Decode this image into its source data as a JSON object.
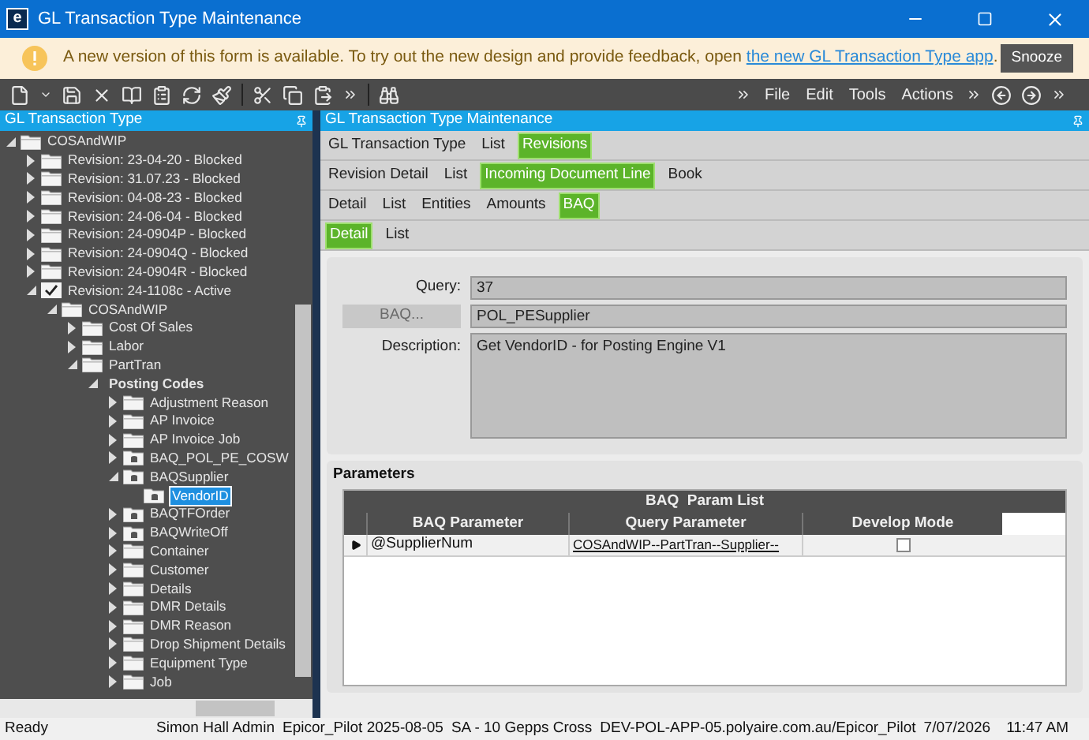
{
  "window": {
    "logo": "e",
    "title": "GL Transaction Type Maintenance"
  },
  "notice": {
    "text": "A new version of this form is available. To try out the new design and provide feedback, open ",
    "link": "the new GL Transaction Type app",
    "after": ".",
    "button": "Snooze"
  },
  "menus": [
    "File",
    "Edit",
    "Tools",
    "Actions"
  ],
  "tree_panel": {
    "title": "GL Transaction Type",
    "items": [
      {
        "label": "COSAndWIP",
        "kind": "folder",
        "expanded": true,
        "selected": false,
        "children": [
          {
            "label": "Revision: 23-04-20 - Blocked",
            "kind": "folder",
            "expanded": false,
            "selected": false
          },
          {
            "label": "Revision: 31.07.23 - Blocked",
            "kind": "folder",
            "expanded": false,
            "selected": false
          },
          {
            "label": "Revision: 04-08-23 - Blocked",
            "kind": "folder",
            "expanded": false,
            "selected": false
          },
          {
            "label": "Revision: 24-06-04 - Blocked",
            "kind": "folder",
            "expanded": false,
            "selected": false
          },
          {
            "label": "Revision: 24-0904P - Blocked",
            "kind": "folder",
            "expanded": false,
            "selected": false
          },
          {
            "label": "Revision: 24-0904Q - Blocked",
            "kind": "folder",
            "expanded": false,
            "selected": false
          },
          {
            "label": "Revision: 24-0904R - Blocked",
            "kind": "folder",
            "expanded": false,
            "selected": false
          },
          {
            "label": "Revision: 24-1108c - Active",
            "kind": "check",
            "expanded": true,
            "selected": false,
            "children": [
              {
                "label": "COSAndWIP",
                "kind": "folder",
                "expanded": true,
                "selected": false,
                "children": [
                  {
                    "label": "Cost Of Sales",
                    "kind": "folder",
                    "expanded": false,
                    "selected": false
                  },
                  {
                    "label": "Labor",
                    "kind": "folder",
                    "expanded": false,
                    "selected": false
                  },
                  {
                    "label": "PartTran",
                    "kind": "folder",
                    "expanded": true,
                    "selected": false,
                    "children": [
                      {
                        "label": "Posting Codes",
                        "kind": "group",
                        "expanded": true,
                        "selected": false,
                        "children": [
                          {
                            "label": "Adjustment Reason",
                            "kind": "folder",
                            "expanded": false,
                            "selected": false
                          },
                          {
                            "label": "AP Invoice",
                            "kind": "folder",
                            "expanded": false,
                            "selected": false
                          },
                          {
                            "label": "AP Invoice Job",
                            "kind": "folder",
                            "expanded": false,
                            "selected": false
                          },
                          {
                            "label": "BAQ_POL_PE_COSW",
                            "kind": "baq",
                            "expanded": false,
                            "selected": false
                          },
                          {
                            "label": "BAQSupplier",
                            "kind": "baq",
                            "expanded": true,
                            "selected": false,
                            "children": [
                              {
                                "label": "VendorID",
                                "kind": "baq",
                                "selected": true
                              }
                            ]
                          },
                          {
                            "label": "BAQTFOrder",
                            "kind": "baq",
                            "expanded": false,
                            "selected": false
                          },
                          {
                            "label": "BAQWriteOff",
                            "kind": "baq",
                            "expanded": false,
                            "selected": false
                          },
                          {
                            "label": "Container",
                            "kind": "folder",
                            "expanded": false,
                            "selected": false
                          },
                          {
                            "label": "Customer",
                            "kind": "folder",
                            "expanded": false,
                            "selected": false
                          },
                          {
                            "label": "Details",
                            "kind": "folder",
                            "expanded": false,
                            "selected": false
                          },
                          {
                            "label": "DMR Details",
                            "kind": "folder",
                            "expanded": false,
                            "selected": false
                          },
                          {
                            "label": "DMR Reason",
                            "kind": "folder",
                            "expanded": false,
                            "selected": false
                          },
                          {
                            "label": "Drop Shipment Details",
                            "kind": "folder",
                            "expanded": false,
                            "selected": false
                          },
                          {
                            "label": "Equipment Type",
                            "kind": "folder",
                            "expanded": false,
                            "selected": false
                          },
                          {
                            "label": "Job",
                            "kind": "folder",
                            "expanded": false,
                            "selected": false
                          }
                        ]
                      }
                    ]
                  }
                ]
              }
            ]
          }
        ]
      }
    ]
  },
  "main_panel": {
    "title": "GL Transaction Type Maintenance",
    "tab_rows": [
      [
        {
          "label": "GL Transaction Type",
          "selected": false
        },
        {
          "label": "List",
          "selected": false
        },
        {
          "label": "Revisions",
          "selected": true
        }
      ],
      [
        {
          "label": "Revision Detail",
          "selected": false
        },
        {
          "label": "List",
          "selected": false
        },
        {
          "label": "Incoming Document Line",
          "selected": true
        },
        {
          "label": "Book",
          "selected": false
        }
      ],
      [
        {
          "label": "Detail",
          "selected": false
        },
        {
          "label": "List",
          "selected": false
        },
        {
          "label": "Entities",
          "selected": false
        },
        {
          "label": "Amounts",
          "selected": false
        },
        {
          "label": "BAQ",
          "selected": true
        }
      ],
      [
        {
          "label": "Detail",
          "selected": true
        },
        {
          "label": "List",
          "selected": false
        }
      ]
    ],
    "query": {
      "label": "Query:",
      "value": "37"
    },
    "baq": {
      "button": "BAQ...",
      "disabled": true,
      "value": "POL_PESupplier"
    },
    "description": {
      "label": "Description:",
      "value": "Get VendorID - for Posting Engine V1"
    },
    "parameters": {
      "title": "Parameters",
      "grid_title": "BAQ  Param List",
      "columns": [
        "BAQ Parameter",
        "Query Parameter",
        "Develop Mode"
      ],
      "rows": [
        {
          "baq_parameter": "@SupplierNum",
          "query_parameter": "COSAndWIP--PartTran--Supplier--",
          "develop_mode": false
        }
      ]
    }
  },
  "status_bar": [
    "Ready",
    "Simon Hall Admin",
    "Epicor_Pilot 2025-08-05",
    "SA - 10 Gepps Cross",
    "DEV-POL-APP-05.polyaire.com.au/Epicor_Pilot",
    "7/07/2026",
    "11:47 AM"
  ]
}
